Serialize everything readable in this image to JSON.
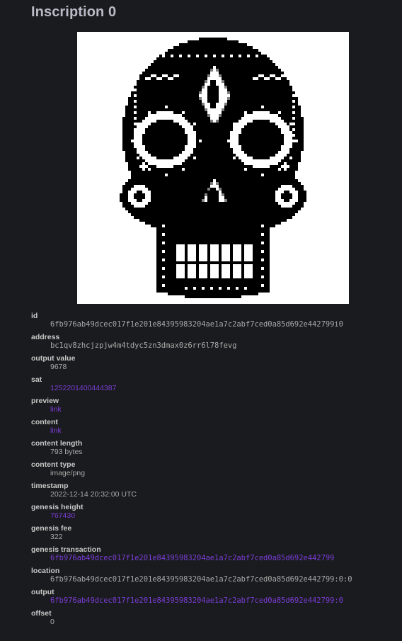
{
  "title": "Inscription 0",
  "image_alt": "sugar skull pixel art",
  "details": [
    {
      "key": "id",
      "label": "id",
      "value": "6fb976ab49dcec017f1e201e84395983204ae1a7c2abf7ced0a85d692e442799i0",
      "link": false,
      "mono": true
    },
    {
      "key": "address",
      "label": "address",
      "value": "bc1qv8zhcjzpjw4m4tdyc5zn3dmax0z6rr6l78fevg",
      "link": false,
      "mono": true
    },
    {
      "key": "output_value",
      "label": "output value",
      "value": "9678",
      "link": false,
      "mono": false
    },
    {
      "key": "sat",
      "label": "sat",
      "value": "1252201400444387",
      "link": true,
      "mono": false
    },
    {
      "key": "preview",
      "label": "preview",
      "value": "link",
      "link": true,
      "mono": false
    },
    {
      "key": "content",
      "label": "content",
      "value": "link",
      "link": true,
      "mono": false
    },
    {
      "key": "content_length",
      "label": "content length",
      "value": "793 bytes",
      "link": false,
      "mono": false
    },
    {
      "key": "content_type",
      "label": "content type",
      "value": "image/png",
      "link": false,
      "mono": false
    },
    {
      "key": "timestamp",
      "label": "timestamp",
      "value": "2022-12-14 20:32:00 UTC",
      "link": false,
      "mono": false
    },
    {
      "key": "genesis_height",
      "label": "genesis height",
      "value": "767430",
      "link": true,
      "mono": false
    },
    {
      "key": "genesis_fee",
      "label": "genesis fee",
      "value": "322",
      "link": false,
      "mono": false
    },
    {
      "key": "genesis_transaction",
      "label": "genesis transaction",
      "value": "6fb976ab49dcec017f1e201e84395983204ae1a7c2abf7ced0a85d692e442799",
      "link": true,
      "mono": true
    },
    {
      "key": "location",
      "label": "location",
      "value": "6fb976ab49dcec017f1e201e84395983204ae1a7c2abf7ced0a85d692e442799:0:0",
      "link": false,
      "mono": true
    },
    {
      "key": "output",
      "label": "output",
      "value": "6fb976ab49dcec017f1e201e84395983204ae1a7c2abf7ced0a85d692e442799:0",
      "link": true,
      "mono": true
    },
    {
      "key": "offset",
      "label": "offset",
      "value": "0",
      "link": false,
      "mono": false
    }
  ],
  "colors": {
    "background": "#1a1b1e",
    "link": "#7a3dd6",
    "label": "#c8c8c8",
    "value": "#a9a9a9"
  }
}
